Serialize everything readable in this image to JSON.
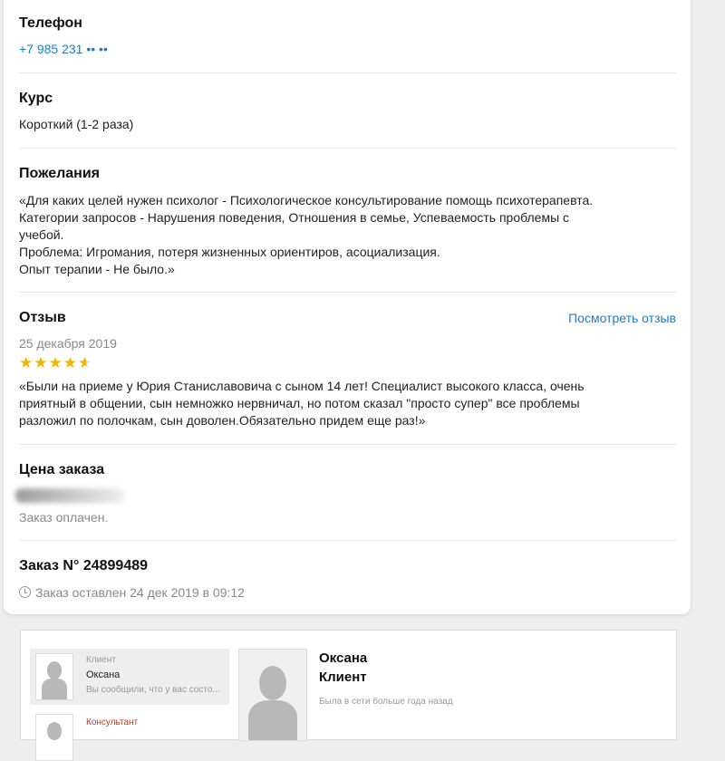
{
  "phone": {
    "label": "Телефон",
    "value": "+7 985 231 •• ••"
  },
  "course": {
    "label": "Курс",
    "value": "Короткий (1-2 раза)"
  },
  "wishes": {
    "label": "Пожелания",
    "lines": [
      "«Для каких целей нужен психолог - Психологическое консультирование помощь психотерапевта.",
      "Категории запросов - Нарушения поведения, Отношения в семье, Успеваемость проблемы с",
      "учебой.",
      "Проблема: Игромания, потеря жизненных ориентиров, асоциализация.",
      "Опыт терапии - Не было.»"
    ]
  },
  "review": {
    "label": "Отзыв",
    "view_link": "Посмотреть отзыв",
    "date": "25 декабря 2019",
    "rating": 4.5,
    "rating_max": 5,
    "lines": [
      "«Были на приеме у Юрия Станиславовича с сыном 14 лет! Специалист высокого класса, очень",
      "приятный в общении, сын немножко нервничал, но потом сказал \"просто супер\" все проблемы",
      "разложил по полочкам, сын доволен.Обязательно придем еще раз!»"
    ]
  },
  "price": {
    "label": "Цена заказа",
    "status": "Заказ оплачен."
  },
  "order": {
    "label": "Заказ N° 24899489",
    "placed": "Заказ оставлен 24 дек 2019 в 09:12"
  },
  "chat": {
    "client_item": {
      "role": "Клиент",
      "name": "Оксана",
      "preview": "Вы сообщили, что у вас состо..."
    },
    "consultant_item": {
      "role": "Консультант"
    },
    "profile": {
      "name": "Оксана",
      "role": "Клиент",
      "status": "Была в сети больше года назад"
    }
  },
  "colors": {
    "link": "#1a7fc1",
    "star": "#f5b301",
    "consultant_role": "#c0392b"
  }
}
